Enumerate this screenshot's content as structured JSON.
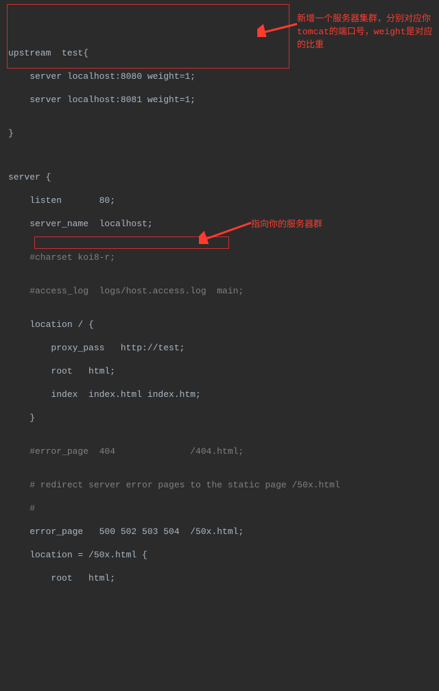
{
  "code": {
    "l1": "upstream  test{",
    "l2": "    server localhost:8080 weight=1;",
    "l3": "    server localhost:8081 weight=1;",
    "l4": "",
    "l5": "}",
    "l6": "",
    "l7": "",
    "l8": "server {",
    "l9": "    listen       80;",
    "l10": "    server_name  localhost;",
    "l11": "",
    "l12": "    #charset koi8-r;",
    "l13": "",
    "l14": "    #access_log  logs/host.access.log  main;",
    "l15": "",
    "l16": "    location / {",
    "l17": "        proxy_pass   http://test;",
    "l18": "        root   html;",
    "l19": "        index  index.html index.htm;",
    "l20": "    }",
    "l21": "",
    "l22": "    #error_page  404              /404.html;",
    "l23": "",
    "l24": "    # redirect server error pages to the static page /50x.html",
    "l25": "    #",
    "l26": "    error_page   500 502 503 504  /50x.html;",
    "l27": "    location = /50x.html {",
    "l28": "        root   html;"
  },
  "annotations": {
    "a1": "新增一个服务器集群，分别对应你tomcat的端口号，weight是对应的比重",
    "a2": "指向你的服务器群"
  },
  "chart_data": {
    "type": "table",
    "title": "nginx configuration snippet",
    "upstream": {
      "name": "test",
      "servers": [
        {
          "host": "localhost",
          "port": 8080,
          "weight": 1
        },
        {
          "host": "localhost",
          "port": 8081,
          "weight": 1
        }
      ]
    },
    "server": {
      "listen": 80,
      "server_name": "localhost",
      "charset_comment": "koi8-r",
      "access_log_comment": "logs/host.access.log  main",
      "location_root": {
        "path": "/",
        "proxy_pass": "http://test",
        "root": "html",
        "index": [
          "index.html",
          "index.htm"
        ]
      },
      "error_page_404_comment": "/404.html",
      "redirect_comment": "redirect server error pages to the static page /50x.html",
      "error_page": {
        "codes": [
          500,
          502,
          503,
          504
        ],
        "target": "/50x.html"
      },
      "location_50x": {
        "path": "/50x.html",
        "root": "html"
      }
    }
  }
}
